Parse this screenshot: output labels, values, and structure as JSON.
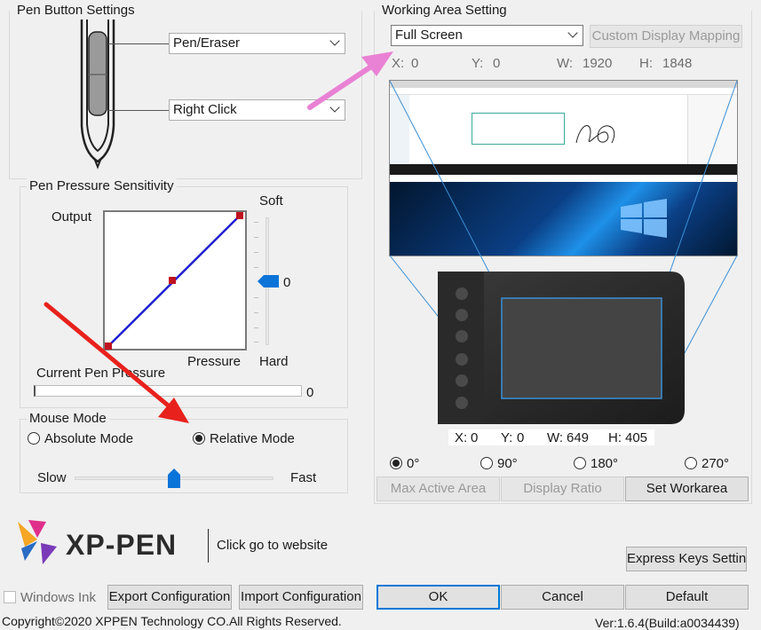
{
  "pen_button": {
    "title": "Pen Button Settings",
    "upper_button": "Pen/Eraser",
    "lower_button": "Right Click"
  },
  "pressure": {
    "title": "Pen Pressure Sensitivity",
    "output_label": "Output",
    "pressure_label": "Pressure",
    "soft_label": "Soft",
    "hard_label": "Hard",
    "slider_value": "0",
    "current_label": "Current Pen Pressure",
    "current_value": "0",
    "current_fraction": 0
  },
  "mouse_mode": {
    "title": "Mouse Mode",
    "absolute": "Absolute Mode",
    "relative": "Relative Mode",
    "selected": "relative",
    "slow": "Slow",
    "fast": "Fast",
    "speed_fraction": 0.5
  },
  "working_area": {
    "title": "Working Area Setting",
    "display_select": "Full Screen",
    "custom_mapping": "Custom Display Mapping",
    "screen": {
      "x_label": "X:",
      "x": "0",
      "y_label": "Y:",
      "y": "0",
      "w_label": "W:",
      "w": "1920",
      "h_label": "H:",
      "h": "1848"
    },
    "tablet": {
      "x_label": "X:",
      "x": "0",
      "y_label": "Y:",
      "y": "0",
      "w_label": "W:",
      "w": "649",
      "h_label": "H:",
      "h": "405"
    },
    "rotations": [
      "0°",
      "90°",
      "180°",
      "270°"
    ],
    "rotation_selected": "0°",
    "max_active_area": "Max Active Area",
    "display_ratio": "Display Ratio",
    "set_workarea": "Set Workarea"
  },
  "brand": {
    "name": "XP-PEN",
    "website": "Click go to website"
  },
  "footer": {
    "express_keys": "Express Keys Setting",
    "windows_ink": "Windows Ink",
    "export": "Export Configuration",
    "import": "Import Configuration",
    "ok": "OK",
    "cancel": "Cancel",
    "default": "Default",
    "copyright": "Copyright©2020  XPPEN Technology CO.All Rights Reserved.",
    "version": "Ver:1.6.4(Build:a0034439)"
  },
  "colors": {
    "annotation_red": "#e8211c",
    "annotation_pink": "#e981d4",
    "curve_blue": "#1f1fd2",
    "slider_blue": "#0a74d8",
    "windows_desktop": "#0b5fb4"
  },
  "icons": [
    "pen-icon",
    "slider-thumb-icon",
    "xp-pen-logo",
    "tablet-icon",
    "arrow-annotation"
  ]
}
